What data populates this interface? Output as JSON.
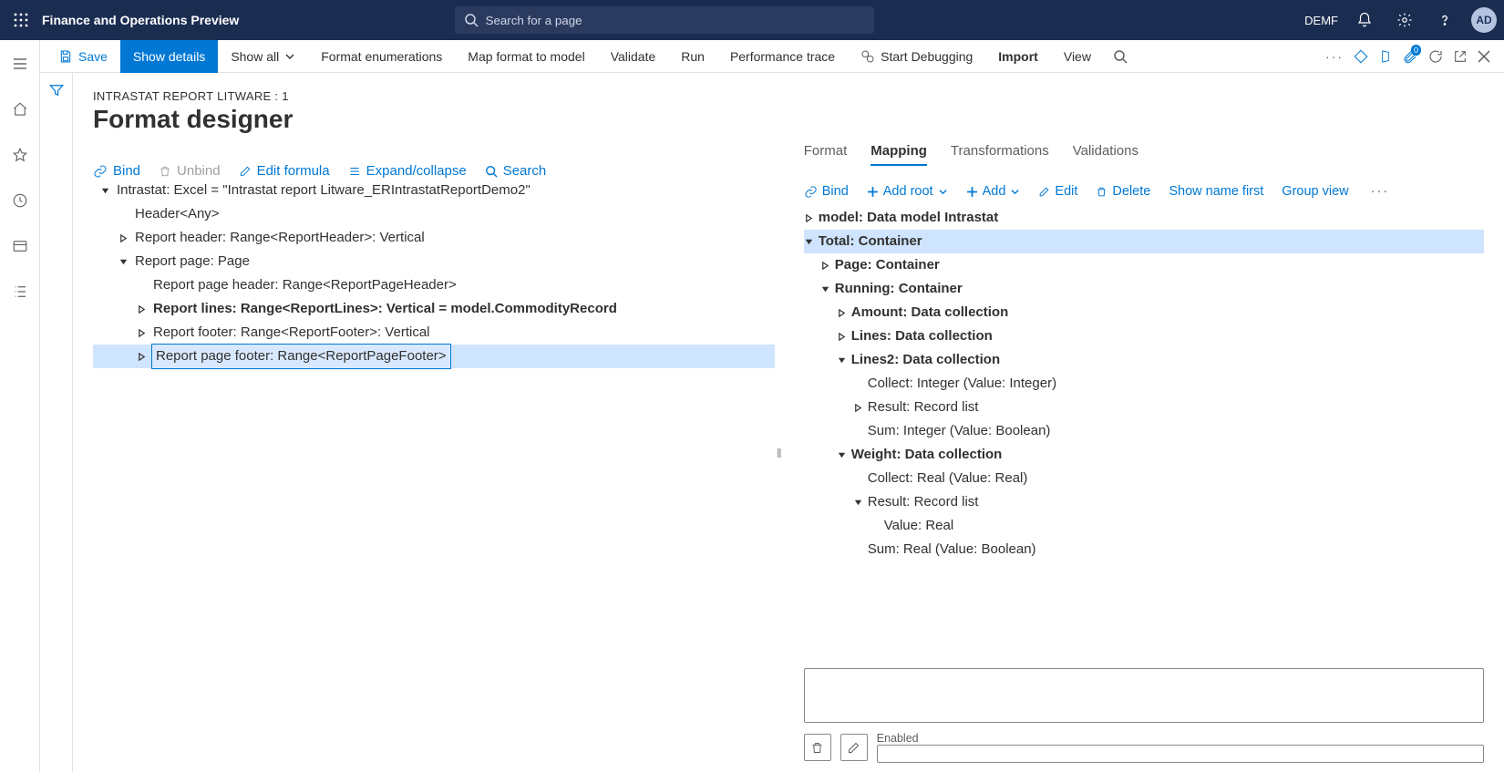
{
  "topbar": {
    "title": "Finance and Operations Preview",
    "search_placeholder": "Search for a page",
    "company": "DEMF",
    "avatar": "AD"
  },
  "actionbar": {
    "save": "Save",
    "show_details": "Show details",
    "show_all": "Show all",
    "format_enumerations": "Format enumerations",
    "map_format_to_model": "Map format to model",
    "validate": "Validate",
    "run": "Run",
    "performance_trace": "Performance trace",
    "start_debugging": "Start Debugging",
    "import": "Import",
    "view": "View",
    "badge": "0"
  },
  "page": {
    "crumb": "INTRASTAT REPORT LITWARE : 1",
    "heading": "Format designer"
  },
  "toolbar2": {
    "bind": "Bind",
    "unbind": "Unbind",
    "edit_formula": "Edit formula",
    "expand_collapse": "Expand/collapse",
    "search": "Search"
  },
  "left_tree": [
    {
      "indent": 0,
      "caret": "down",
      "bold": false,
      "selected": false,
      "text": "Intrastat: Excel = \"Intrastat report Litware_ERIntrastatReportDemo2\""
    },
    {
      "indent": 1,
      "caret": "none",
      "bold": false,
      "selected": false,
      "text": "Header<Any>"
    },
    {
      "indent": 1,
      "caret": "right",
      "bold": false,
      "selected": false,
      "text": "Report header: Range<ReportHeader>: Vertical"
    },
    {
      "indent": 1,
      "caret": "down",
      "bold": false,
      "selected": false,
      "text": "Report page: Page"
    },
    {
      "indent": 2,
      "caret": "none",
      "bold": false,
      "selected": false,
      "text": "Report page header: Range<ReportPageHeader>"
    },
    {
      "indent": 2,
      "caret": "right",
      "bold": true,
      "selected": false,
      "text": "Report lines: Range<ReportLines>: Vertical = model.CommodityRecord"
    },
    {
      "indent": 2,
      "caret": "right",
      "bold": false,
      "selected": false,
      "text": "Report footer: Range<ReportFooter>: Vertical"
    },
    {
      "indent": 2,
      "caret": "right",
      "bold": false,
      "selected": true,
      "text": "Report page footer: Range<ReportPageFooter>"
    }
  ],
  "right_pane": {
    "tabs": {
      "format": "Format",
      "mapping": "Mapping",
      "transformations": "Transformations",
      "validations": "Validations"
    },
    "toolbar": {
      "bind": "Bind",
      "add_root": "Add root",
      "add": "Add",
      "edit": "Edit",
      "delete": "Delete",
      "show_name_first": "Show name first",
      "group_view": "Group view"
    },
    "tree": [
      {
        "indent": 0,
        "caret": "right",
        "bold": true,
        "highlight": false,
        "text": "model: Data model Intrastat"
      },
      {
        "indent": 0,
        "caret": "down",
        "bold": true,
        "highlight": true,
        "text": "Total: Container"
      },
      {
        "indent": 1,
        "caret": "right",
        "bold": true,
        "highlight": false,
        "text": "Page: Container"
      },
      {
        "indent": 1,
        "caret": "down",
        "bold": true,
        "highlight": false,
        "text": "Running: Container"
      },
      {
        "indent": 2,
        "caret": "right",
        "bold": true,
        "highlight": false,
        "text": "Amount: Data collection"
      },
      {
        "indent": 2,
        "caret": "right",
        "bold": true,
        "highlight": false,
        "text": "Lines: Data collection"
      },
      {
        "indent": 2,
        "caret": "down",
        "bold": true,
        "highlight": false,
        "text": "Lines2: Data collection"
      },
      {
        "indent": 3,
        "caret": "none",
        "bold": false,
        "highlight": false,
        "text": "Collect: Integer (Value: Integer)"
      },
      {
        "indent": 3,
        "caret": "right",
        "bold": false,
        "highlight": false,
        "text": "Result: Record list"
      },
      {
        "indent": 3,
        "caret": "none",
        "bold": false,
        "highlight": false,
        "text": "Sum: Integer (Value: Boolean)"
      },
      {
        "indent": 2,
        "caret": "down",
        "bold": true,
        "highlight": false,
        "text": "Weight: Data collection"
      },
      {
        "indent": 3,
        "caret": "none",
        "bold": false,
        "highlight": false,
        "text": "Collect: Real (Value: Real)"
      },
      {
        "indent": 3,
        "caret": "down",
        "bold": false,
        "highlight": false,
        "text": "Result: Record list"
      },
      {
        "indent": 4,
        "caret": "none",
        "bold": false,
        "highlight": false,
        "text": "Value: Real"
      },
      {
        "indent": 3,
        "caret": "none",
        "bold": false,
        "highlight": false,
        "text": "Sum: Real (Value: Boolean)"
      }
    ],
    "enabled_label": "Enabled",
    "enabled_value": ""
  }
}
